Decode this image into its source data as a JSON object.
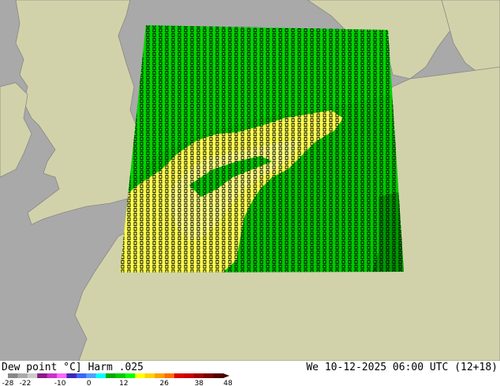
{
  "header": {
    "title": "Dew point °C] Harm .025",
    "datetime": "We 10-12-2025 06:00 UTC (12+18)"
  },
  "legend": {
    "tick_labels": [
      "-28",
      "-22",
      "-10",
      "0",
      "12",
      "26",
      "38",
      "48"
    ],
    "tick_values": [
      -28,
      -22,
      -10,
      0,
      12,
      26,
      38,
      48
    ],
    "range": [
      -28,
      48
    ],
    "colors": [
      "#888888",
      "#aaaaaa",
      "#cccccc",
      "#8b1a8b",
      "#c832c8",
      "#ff64ff",
      "#3c28b4",
      "#3c64ff",
      "#50a0ff",
      "#00ffff",
      "#00aa00",
      "#00cc00",
      "#00ff00",
      "#ffff00",
      "#ffd200",
      "#ffa000",
      "#ff6e00",
      "#dc0000",
      "#c80000",
      "#a00000",
      "#780000",
      "#500000"
    ]
  },
  "map": {
    "land_color": "#d2d2aa",
    "sea_color": "#a9a9a9",
    "value_colors": {
      "green": "#00c800",
      "light_green": "#00e000",
      "dark_green": "#009600",
      "yellow": "#ffff50",
      "light_yellow": "#ffff80"
    }
  }
}
